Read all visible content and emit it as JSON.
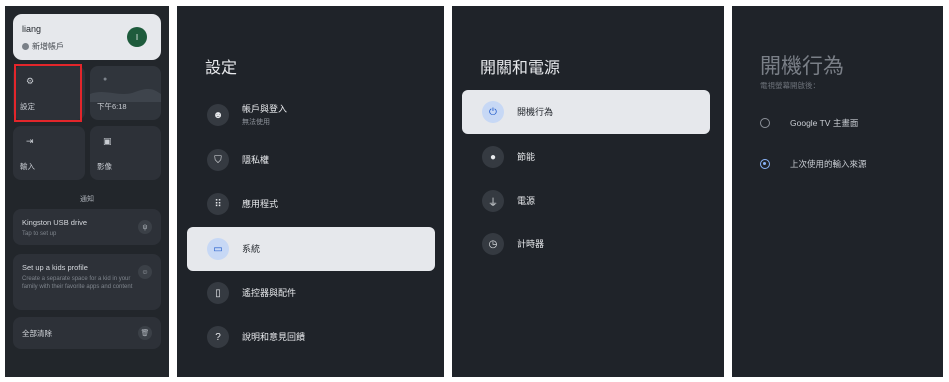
{
  "panel1": {
    "account": {
      "name": "liang",
      "add_label": "新增帳戶",
      "avatar_letter": "l"
    },
    "tiles": [
      {
        "label": "設定",
        "icon": "gear-icon",
        "glyph": "⚙"
      },
      {
        "label": "下午6:18",
        "icon": "weather-icon",
        "glyph": "●"
      },
      {
        "label": "輸入",
        "icon": "input-icon",
        "glyph": "⇥"
      },
      {
        "label": "影像",
        "icon": "picture-icon",
        "glyph": "▣"
      }
    ],
    "notifications_header": "通知",
    "notifications": [
      {
        "title": "Kingston USB drive",
        "subtitle": "Tap to set up",
        "icon": "usb-icon",
        "glyph": "ψ"
      },
      {
        "title": "Set up a kids profile",
        "subtitle": "Create a separate space for a kid in your family with their favorite apps and content",
        "icon": "kids-icon",
        "glyph": "☺"
      },
      {
        "title": "全部清除",
        "subtitle": "",
        "icon": "trash-icon",
        "glyph": "🗑"
      }
    ]
  },
  "panel2": {
    "title": "設定",
    "items": [
      {
        "label": "帳戶與登入",
        "sublabel": "無法使用",
        "icon": "account-icon",
        "glyph": "☻"
      },
      {
        "label": "隱私權",
        "sublabel": "",
        "icon": "shield-icon",
        "glyph": "⛉"
      },
      {
        "label": "應用程式",
        "sublabel": "",
        "icon": "apps-grid-icon",
        "glyph": "⠿"
      },
      {
        "label": "系統",
        "sublabel": "",
        "icon": "tv-icon",
        "glyph": "▭"
      },
      {
        "label": "遙控器與配件",
        "sublabel": "",
        "icon": "remote-icon",
        "glyph": "▯"
      },
      {
        "label": "說明和意見回饋",
        "sublabel": "",
        "icon": "help-icon",
        "glyph": "?"
      }
    ]
  },
  "panel3": {
    "title": "開關和電源",
    "items": [
      {
        "label": "開機行為",
        "icon": "power-icon",
        "glyph": "⏻"
      },
      {
        "label": "節能",
        "icon": "bulb-icon",
        "glyph": "●"
      },
      {
        "label": "電源",
        "icon": "plug-icon",
        "glyph": "⏚"
      },
      {
        "label": "計時器",
        "icon": "clock-icon",
        "glyph": "◷"
      }
    ]
  },
  "panel4": {
    "title": "開機行為",
    "subtitle": "電視螢幕開啟後：",
    "options": [
      {
        "label": "Google TV 主畫面",
        "selected": false
      },
      {
        "label": "上次使用的輸入來源",
        "selected": true
      }
    ]
  }
}
